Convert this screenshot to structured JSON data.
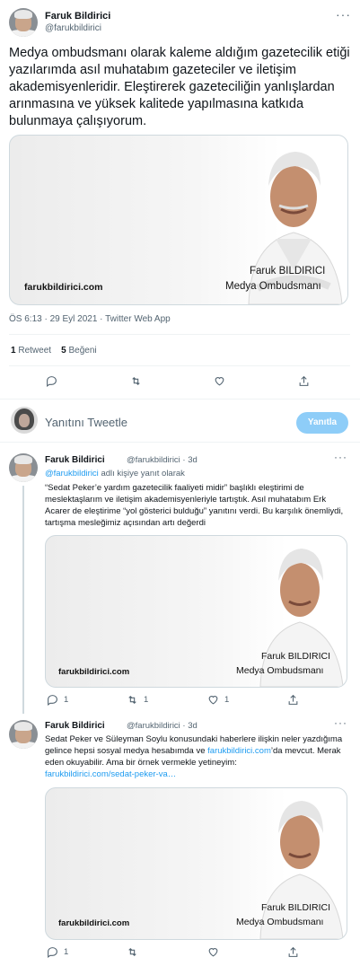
{
  "main_tweet": {
    "author_name": "Faruk Bildirici",
    "author_handle": "@farukbildirici",
    "text": "Medya ombudsmanı olarak kaleme aldığım gazetecilik etiği yazılarımda asıl muhatabım gazeteciler ve iletişim akademisyenleridir.  Eleştirerek gazeteciliğin yanlışlardan arınmasına ve yüksek kalitede yapılmasına katkıda bulunmaya çalışıyorum.",
    "card": {
      "site": "farukbildirici.com",
      "caption_name": "Faruk BILDIRICI",
      "caption_title": "Medya Ombudsmanı"
    },
    "meta": "ÖS 6:13 · 29 Eyl 2021 · Twitter Web App",
    "retweet_count": "1",
    "retweet_label": "Retweet",
    "like_count": "5",
    "like_label": "Beğeni"
  },
  "reply_bar": {
    "placeholder": "Yanıtını Tweetle",
    "button": "Yanıtla"
  },
  "replies": [
    {
      "author_name": "Faruk Bildirici",
      "author_handle": "@farukbildirici · 3d",
      "reply_to_handle": "@farukbildirici",
      "reply_to_suffix": " adlı kişiye yanıt olarak",
      "text": "“Sedat Peker’e yardım gazetecilik faaliyeti midir” başlıklı eleştirimi de meslektaşlarım  ve iletişim akademisyenleriyle tartıştık. Asıl muhatabım Erk Acarer de eleştirime “yol gösterici bulduğu” yanıtını verdi. Bu karşılık önemliydi, tartışma mesleğimiz açısından artı değerdi",
      "card": {
        "site": "farukbildirici.com",
        "caption_name": "Faruk BILDIRICI",
        "caption_title": "Medya Ombudsmanı"
      },
      "reply_count": "1",
      "retweet_count": "1",
      "like_count": "1"
    },
    {
      "author_name": "Faruk Bildirici",
      "author_handle": "@farukbildirici · 3d",
      "text_before_link": "Sedat Peker ve Süleyman Soylu konusundaki haberlere ilişkin neler yazdığıma gelince hepsi sosyal medya hesabımda ve ",
      "inline_link": "farukbildirici.com",
      "text_after_link": "’da mevcut. Merak eden okuyabilir. Ama bir örnek vermekle yetineyim:",
      "url_link": "farukbildirici.com/sedat-peker-va…",
      "card": {
        "site": "farukbildirici.com",
        "caption_name": "Faruk BILDIRICI",
        "caption_title": "Medya Ombudsmanı"
      },
      "reply_count": "1"
    }
  ],
  "colors": {
    "link": "#1d9bf0",
    "muted": "#536471",
    "reply_button": "#8ecdf8"
  },
  "icons": [
    "more-icon",
    "reply-icon",
    "retweet-icon",
    "like-icon",
    "share-icon"
  ]
}
